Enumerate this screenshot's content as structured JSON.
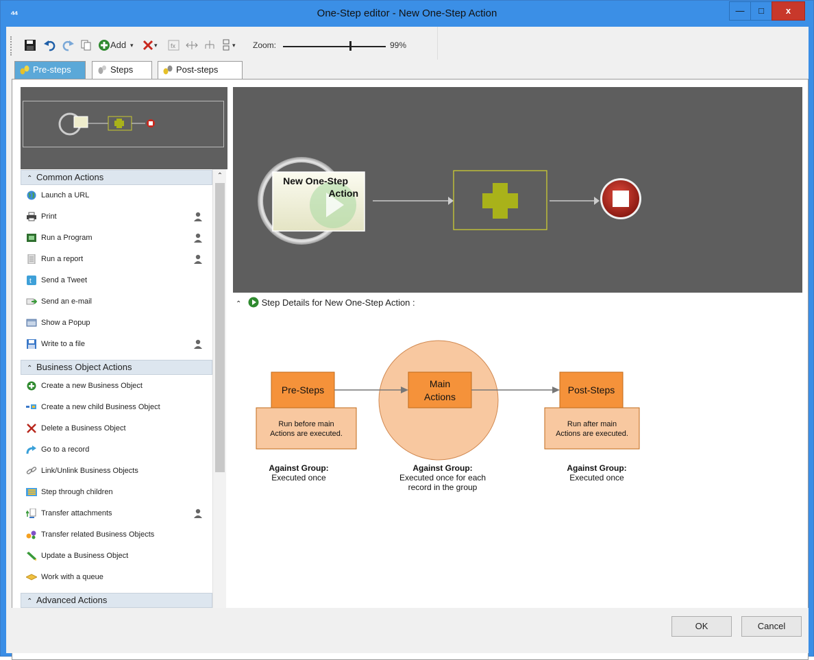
{
  "window": {
    "title": "One-Step editor - New One-Step Action",
    "minimize_label": "—",
    "maximize_label": "□",
    "close_label": "x"
  },
  "toolbar": {
    "add_label": "Add",
    "zoom_label": "Zoom:",
    "zoom_value": "99%"
  },
  "tabs": [
    {
      "label": "Pre-steps",
      "active": true
    },
    {
      "label": "Steps",
      "active": false
    },
    {
      "label": "Post-steps",
      "active": false
    }
  ],
  "canvas": {
    "start_node_label_line1": "New One-Step",
    "start_node_label_line2": "Action"
  },
  "sections": [
    {
      "title": "Common Actions",
      "items": [
        {
          "label": "Launch a URL",
          "icon": "globe-icon",
          "user": false
        },
        {
          "label": "Print",
          "icon": "printer-icon",
          "user": true
        },
        {
          "label": "Run a Program",
          "icon": "program-icon",
          "user": true
        },
        {
          "label": "Run a report",
          "icon": "report-icon",
          "user": true
        },
        {
          "label": "Send a Tweet",
          "icon": "twitter-icon",
          "user": false
        },
        {
          "label": "Send an e-mail",
          "icon": "email-icon",
          "user": false
        },
        {
          "label": "Show a Popup",
          "icon": "popup-icon",
          "user": false
        },
        {
          "label": "Write to a file",
          "icon": "save-file-icon",
          "user": true
        }
      ]
    },
    {
      "title": "Business Object Actions",
      "items": [
        {
          "label": "Create a new Business Object",
          "icon": "plus-circle-icon",
          "user": false
        },
        {
          "label": "Create a new child Business Object",
          "icon": "child-object-icon",
          "user": false
        },
        {
          "label": "Delete a Business Object",
          "icon": "delete-x-icon",
          "user": false
        },
        {
          "label": "Go to a record",
          "icon": "goto-arrow-icon",
          "user": false
        },
        {
          "label": "Link/Unlink Business Objects",
          "icon": "link-icon",
          "user": false
        },
        {
          "label": "Step through children",
          "icon": "children-list-icon",
          "user": false
        },
        {
          "label": "Transfer attachments",
          "icon": "transfer-attachment-icon",
          "user": true
        },
        {
          "label": "Transfer related Business Objects",
          "icon": "transfer-related-icon",
          "user": false
        },
        {
          "label": "Update a Business Object",
          "icon": "pencil-icon",
          "user": false
        },
        {
          "label": "Work with a queue",
          "icon": "queue-icon",
          "user": false
        }
      ]
    },
    {
      "title": "Advanced Actions",
      "items": []
    }
  ],
  "details": {
    "header": "Step Details for New One-Step Action :",
    "pre_steps": {
      "title": "Pre-Steps",
      "note_line1": "Run before main",
      "note_line2": "Actions are executed.",
      "against_label": "Against Group:",
      "against_value": "Executed once"
    },
    "main_actions": {
      "title_line1": "Main",
      "title_line2": "Actions",
      "against_label": "Against Group:",
      "against_value_line1": "Executed once for each",
      "against_value_line2": "record in the group"
    },
    "post_steps": {
      "title": "Post-Steps",
      "note_line1": "Run after main",
      "note_line2": "Actions are executed.",
      "against_label": "Against Group:",
      "against_value": "Executed once"
    }
  },
  "footer": {
    "ok_label": "OK",
    "cancel_label": "Cancel"
  },
  "colors": {
    "titlebar": "#3b8fe6",
    "close_button": "#c8382b",
    "canvas_bg": "#5e5e5e",
    "add_placeholder": "#a9b21a",
    "stop_node": "#b8281e",
    "diagram_box": "#f5a04a",
    "diagram_light": "#f8c8a0"
  }
}
